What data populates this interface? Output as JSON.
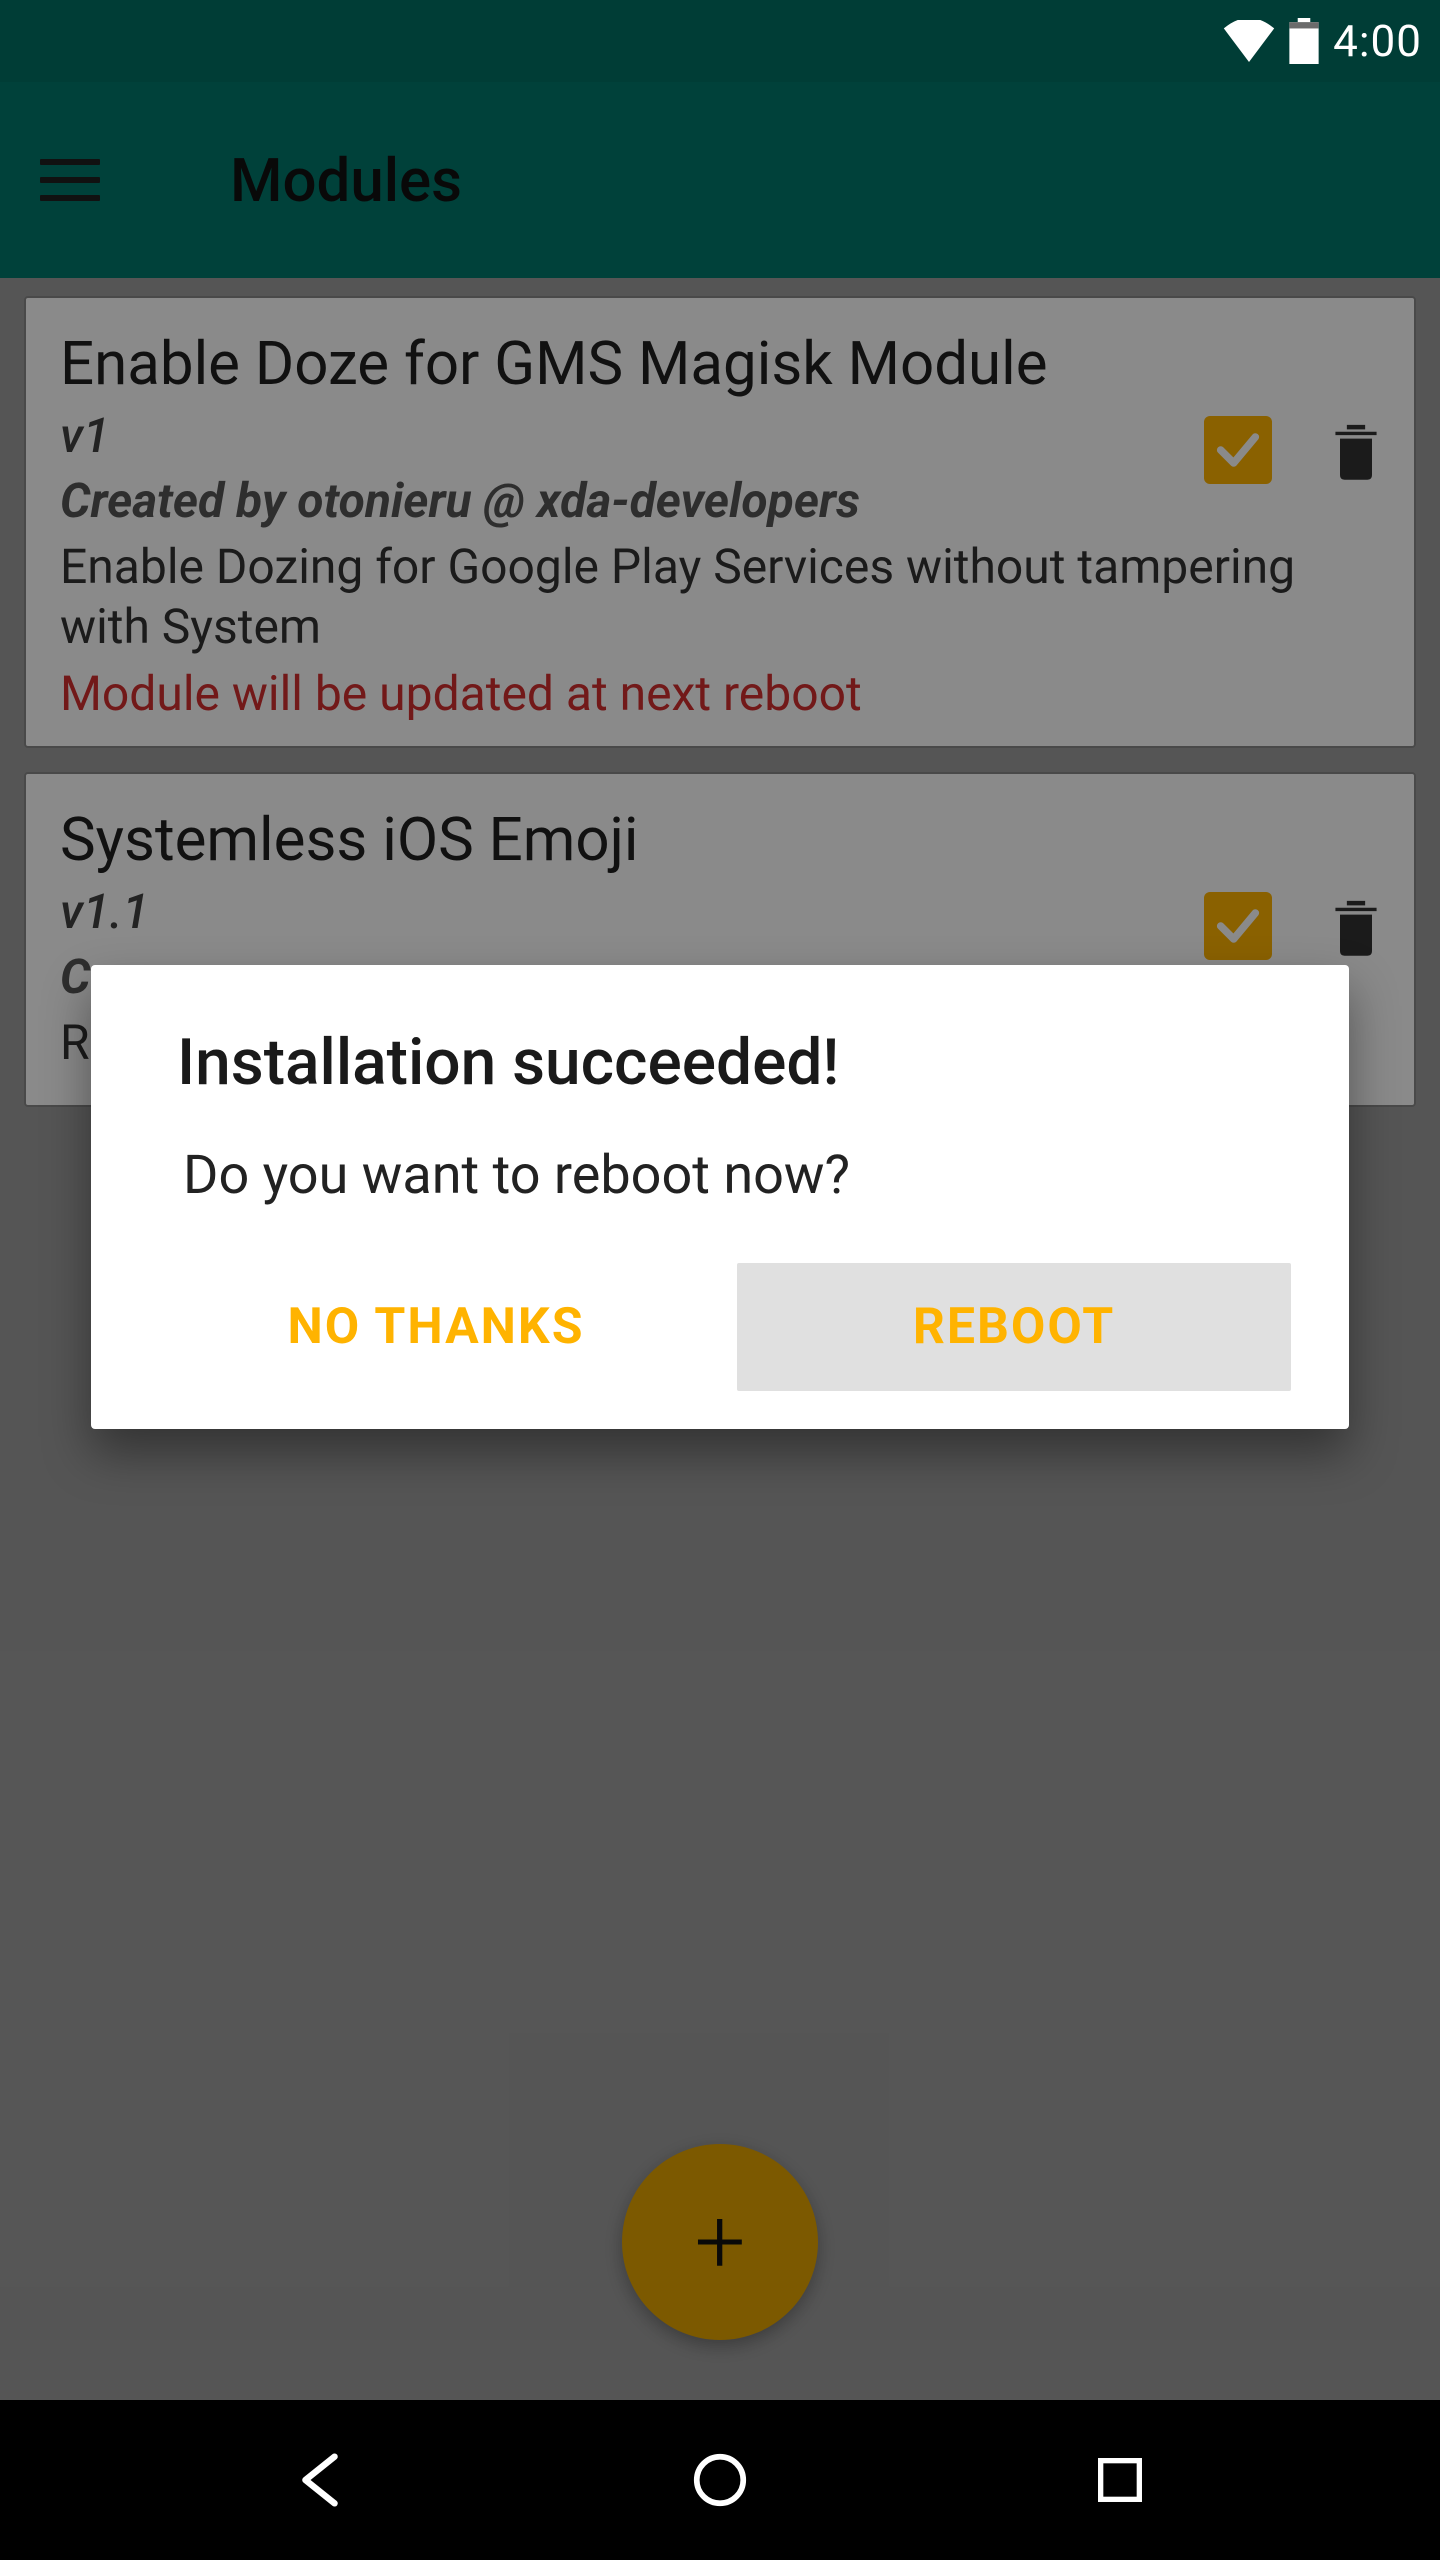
{
  "status": {
    "time": "4:00"
  },
  "appbar": {
    "title": "Modules"
  },
  "modules": [
    {
      "title": "Enable Doze for GMS Magisk Module",
      "version": "v1",
      "author": "Created by otonieru @ xda-developers",
      "description": "Enable Dozing for Google Play Services without tampering with System",
      "status": "Module will be updated at next reboot"
    },
    {
      "title": "Systemless iOS Emoji",
      "version": "v1.1",
      "author": "C",
      "description": "R",
      "status": ""
    }
  ],
  "dialog": {
    "title": "Installation succeeded!",
    "message": "Do you want to reboot now?",
    "negative": "NO THANKS",
    "positive": "REBOOT"
  },
  "colors": {
    "accent": "#ffb300",
    "teal": "#00796b",
    "tealDark": "#003d36",
    "danger": "#d32f2f"
  }
}
